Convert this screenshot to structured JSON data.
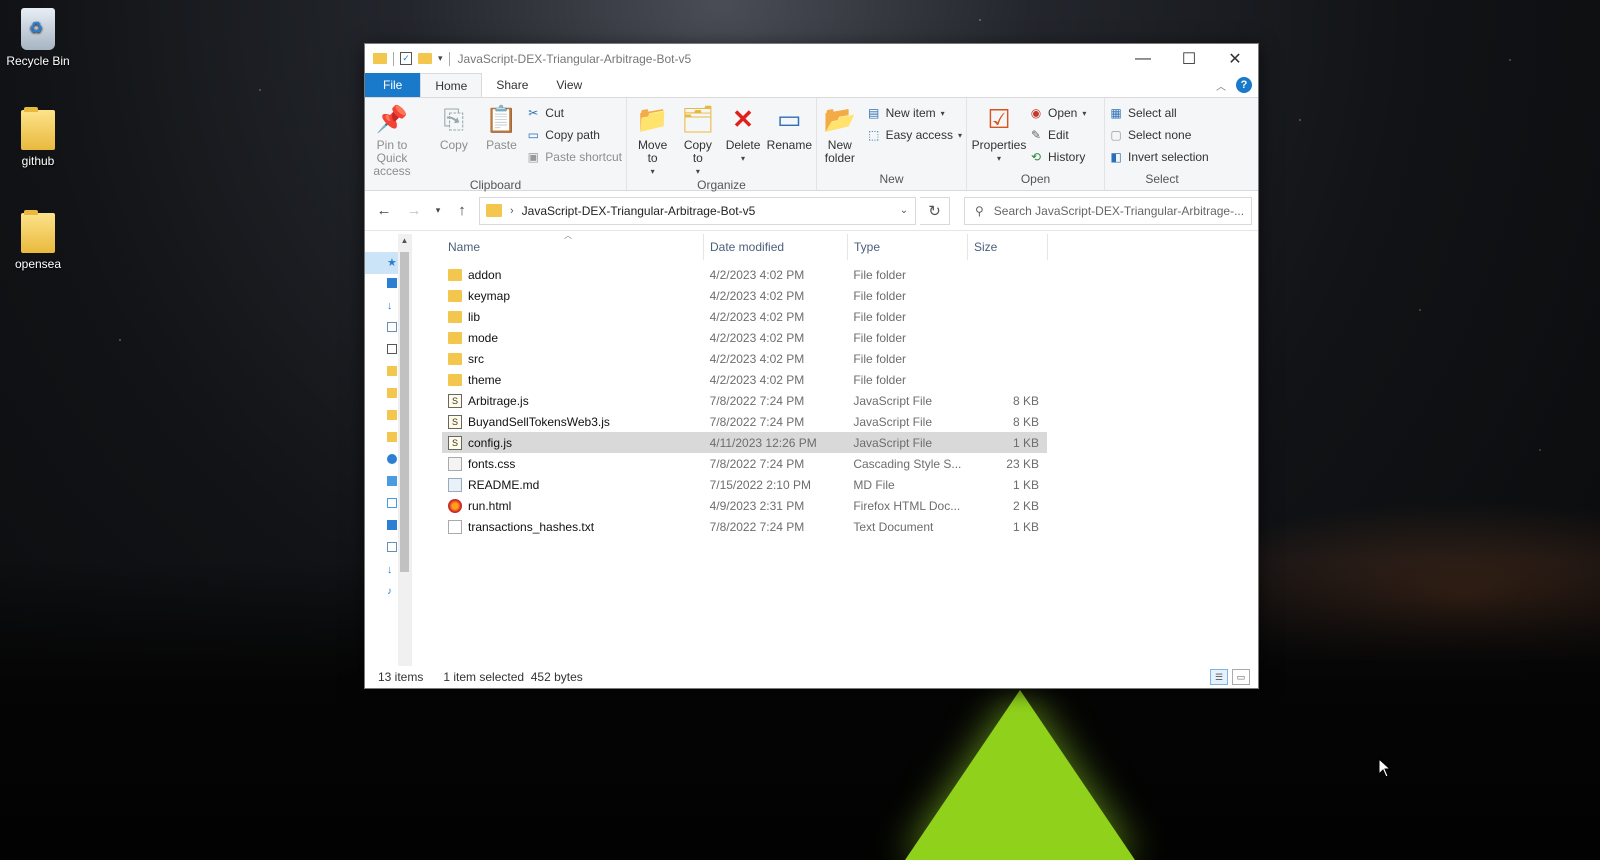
{
  "desktop": {
    "icons": [
      {
        "label": "Recycle Bin"
      },
      {
        "label": "github"
      },
      {
        "label": "opensea"
      }
    ]
  },
  "window": {
    "title": "JavaScript-DEX-Triangular-Arbitrage-Bot-v5",
    "controls": {
      "minimize": "—",
      "maximize": "☐",
      "close": "✕"
    }
  },
  "ribbon_tabs": [
    "File",
    "Home",
    "Share",
    "View"
  ],
  "ribbon": {
    "clipboard": {
      "label": "Clipboard",
      "pin": "Pin to Quick access",
      "copy": "Copy",
      "paste": "Paste",
      "cut": "Cut",
      "copy_path": "Copy path",
      "paste_shortcut": "Paste shortcut"
    },
    "organize": {
      "label": "Organize",
      "move_to": "Move to",
      "copy_to": "Copy to",
      "delete": "Delete",
      "rename": "Rename"
    },
    "new": {
      "label": "New",
      "new_folder": "New folder",
      "new_item": "New item",
      "easy_access": "Easy access"
    },
    "open": {
      "label": "Open",
      "properties": "Properties",
      "open": "Open",
      "edit": "Edit",
      "history": "History"
    },
    "select": {
      "label": "Select",
      "select_all": "Select all",
      "select_none": "Select none",
      "invert": "Invert selection"
    }
  },
  "address": {
    "path": "JavaScript-DEX-Triangular-Arbitrage-Bot-v5",
    "search_placeholder": "Search JavaScript-DEX-Triangular-Arbitrage-..."
  },
  "columns": {
    "name": "Name",
    "date": "Date modified",
    "type": "Type",
    "size": "Size"
  },
  "files": [
    {
      "name": "addon",
      "date": "4/2/2023 4:02 PM",
      "type": "File folder",
      "size": "",
      "icon": "folder"
    },
    {
      "name": "keymap",
      "date": "4/2/2023 4:02 PM",
      "type": "File folder",
      "size": "",
      "icon": "folder"
    },
    {
      "name": "lib",
      "date": "4/2/2023 4:02 PM",
      "type": "File folder",
      "size": "",
      "icon": "folder"
    },
    {
      "name": "mode",
      "date": "4/2/2023 4:02 PM",
      "type": "File folder",
      "size": "",
      "icon": "folder"
    },
    {
      "name": "src",
      "date": "4/2/2023 4:02 PM",
      "type": "File folder",
      "size": "",
      "icon": "folder"
    },
    {
      "name": "theme",
      "date": "4/2/2023 4:02 PM",
      "type": "File folder",
      "size": "",
      "icon": "folder"
    },
    {
      "name": "Arbitrage.js",
      "date": "7/8/2022 7:24 PM",
      "type": "JavaScript File",
      "size": "8 KB",
      "icon": "js"
    },
    {
      "name": "BuyandSellTokensWeb3.js",
      "date": "7/8/2022 7:24 PM",
      "type": "JavaScript File",
      "size": "8 KB",
      "icon": "js"
    },
    {
      "name": "config.js",
      "date": "4/11/2023 12:26 PM",
      "type": "JavaScript File",
      "size": "1 KB",
      "icon": "js",
      "selected": true
    },
    {
      "name": "fonts.css",
      "date": "7/8/2022 7:24 PM",
      "type": "Cascading Style S...",
      "size": "23 KB",
      "icon": "css"
    },
    {
      "name": "README.md",
      "date": "7/15/2022 2:10 PM",
      "type": "MD File",
      "size": "1 KB",
      "icon": "md"
    },
    {
      "name": "run.html",
      "date": "4/9/2023 2:31 PM",
      "type": "Firefox HTML Doc...",
      "size": "2 KB",
      "icon": "html"
    },
    {
      "name": "transactions_hashes.txt",
      "date": "7/8/2022 7:24 PM",
      "type": "Text Document",
      "size": "1 KB",
      "icon": "txt"
    }
  ],
  "status": {
    "count": "13 items",
    "selection": "1 item selected  452 bytes"
  }
}
